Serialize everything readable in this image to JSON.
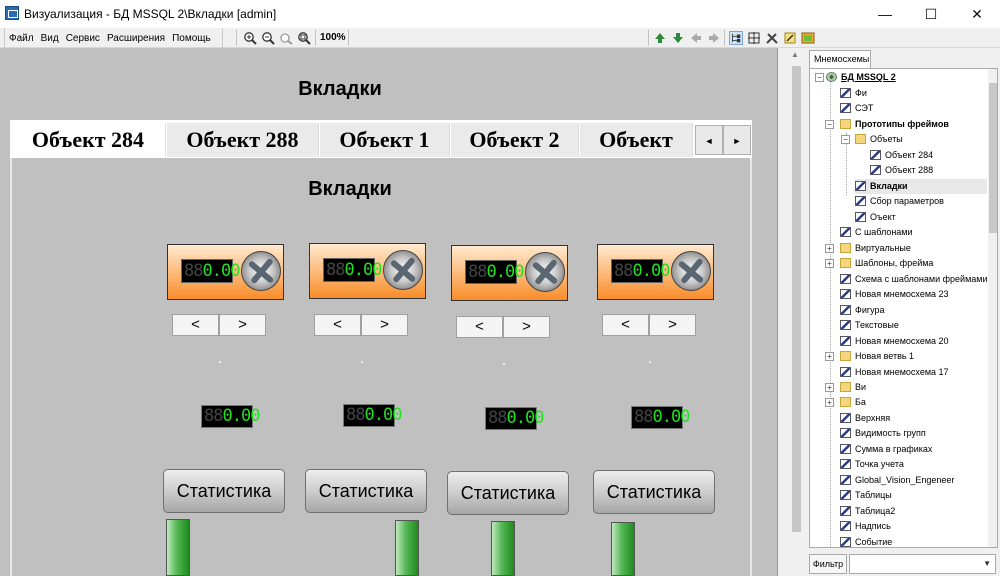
{
  "window": {
    "title": "Визуализация - БД MSSQL 2\\Вкладки [admin]",
    "minimize": "—",
    "maximize": "☐",
    "close": "✕"
  },
  "menu": [
    "Файл",
    "Вид",
    "Сервис",
    "Расширения",
    "Помощь"
  ],
  "toolbar": {
    "zoom": "100%"
  },
  "frame": {
    "title": "Вкладки",
    "tabs": [
      "Объект 284",
      "Объект 288",
      "Объект 1",
      "Объект 2",
      "Объект"
    ],
    "active_tab": 0,
    "tab_prev": "◄",
    "tab_next": "►",
    "inner_title": "Вкладки",
    "objects": [
      {
        "lcd_dim": "88",
        "lcd_value": "0.00",
        "left": "<",
        "right": ">",
        "lcd2_dim": "88",
        "lcd2_value": "0.00",
        "button": "Статистика"
      },
      {
        "lcd_dim": "88",
        "lcd_value": "0.00",
        "left": "<",
        "right": ">",
        "lcd2_dim": "88",
        "lcd2_value": "0.00",
        "button": "Статистика"
      },
      {
        "lcd_dim": "88",
        "lcd_value": "0.00",
        "left": "<",
        "right": ">",
        "lcd2_dim": "88",
        "lcd2_value": "0.00",
        "button": "Статистика"
      },
      {
        "lcd_dim": "88",
        "lcd_value": "0.00",
        "left": "<",
        "right": ">",
        "lcd2_dim": "88",
        "lcd2_value": "0.00",
        "button": "Статистика"
      }
    ]
  },
  "panel": {
    "tab": "Мнемосхемы",
    "filter_label": "Фильтр",
    "filter_value": "",
    "tree": [
      "БД MSSQL 2",
      "Фи",
      "СЭТ",
      "Прототипы фреймов",
      "Объеты",
      "Объект 284",
      "Объект 288",
      "Вкладки",
      "Сбор параметров",
      "Оъект",
      "С шаблонами",
      "Виртуальные",
      "Шаблоны, фрейма",
      "Схема с шаблонами фреймами",
      "Новая мнемосхема 23",
      "Фигура",
      "Текстовые",
      "Новая мнемосхема 20",
      "Новая ветвь 1",
      "Новая мнемосхема 17",
      "Ви",
      "Ба",
      "Верхняя",
      "Видимость групп",
      "Сумма в графиках",
      "Точка учета",
      "Global_Vision_Engeneer",
      "Таблицы",
      "Таблица2",
      "Надпись",
      "Событие"
    ]
  }
}
